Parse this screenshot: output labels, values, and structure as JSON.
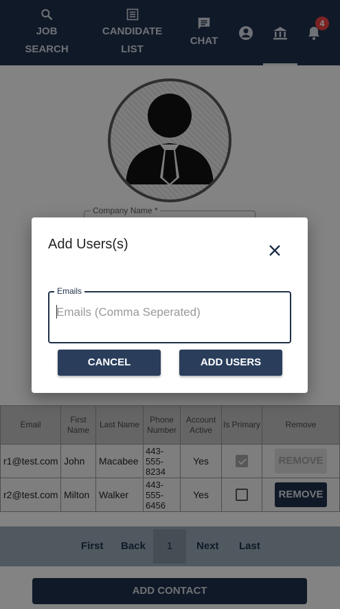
{
  "nav": {
    "job_search_line1": "JOB",
    "job_search_line2": "SEARCH",
    "candidate_line1": "CANDIDATE",
    "candidate_line2": "LIST",
    "chat": "CHAT",
    "notification_count": "4",
    "icons": [
      "search-icon",
      "list-icon",
      "chat-icon",
      "account-circle-icon",
      "bank-icon",
      "bell-icon"
    ]
  },
  "profile": {
    "company_name_label": "Company Name *"
  },
  "table": {
    "headers": [
      "Email",
      "First Name",
      "Last Name",
      "Phone Number",
      "Account Active",
      "Is Primary",
      "Remove"
    ],
    "rows": [
      {
        "email": "r1@test.com",
        "first": "John",
        "last": "Macabee",
        "phone": "443-555-8234",
        "active": "Yes",
        "primary": true,
        "remove": "REMOVE"
      },
      {
        "email": "r2@test.com",
        "first": "Milton",
        "last": "Walker",
        "phone": "443-555-6456",
        "active": "Yes",
        "primary": false,
        "remove": "REMOVE"
      }
    ]
  },
  "pager": {
    "first": "First",
    "back": "Back",
    "current": "1",
    "next": "Next",
    "last": "Last"
  },
  "add_contact": "ADD CONTACT",
  "dialog": {
    "title": "Add Users(s)",
    "emails_label": "Emails",
    "emails_placeholder": "Emails (Comma Seperated)",
    "emails_value": "",
    "cancel": "CANCEL",
    "add_users": "ADD USERS"
  },
  "colors": {
    "nav_bg": "#1e2f47",
    "button_bg": "#2a3e5c",
    "badge": "#e04040"
  }
}
